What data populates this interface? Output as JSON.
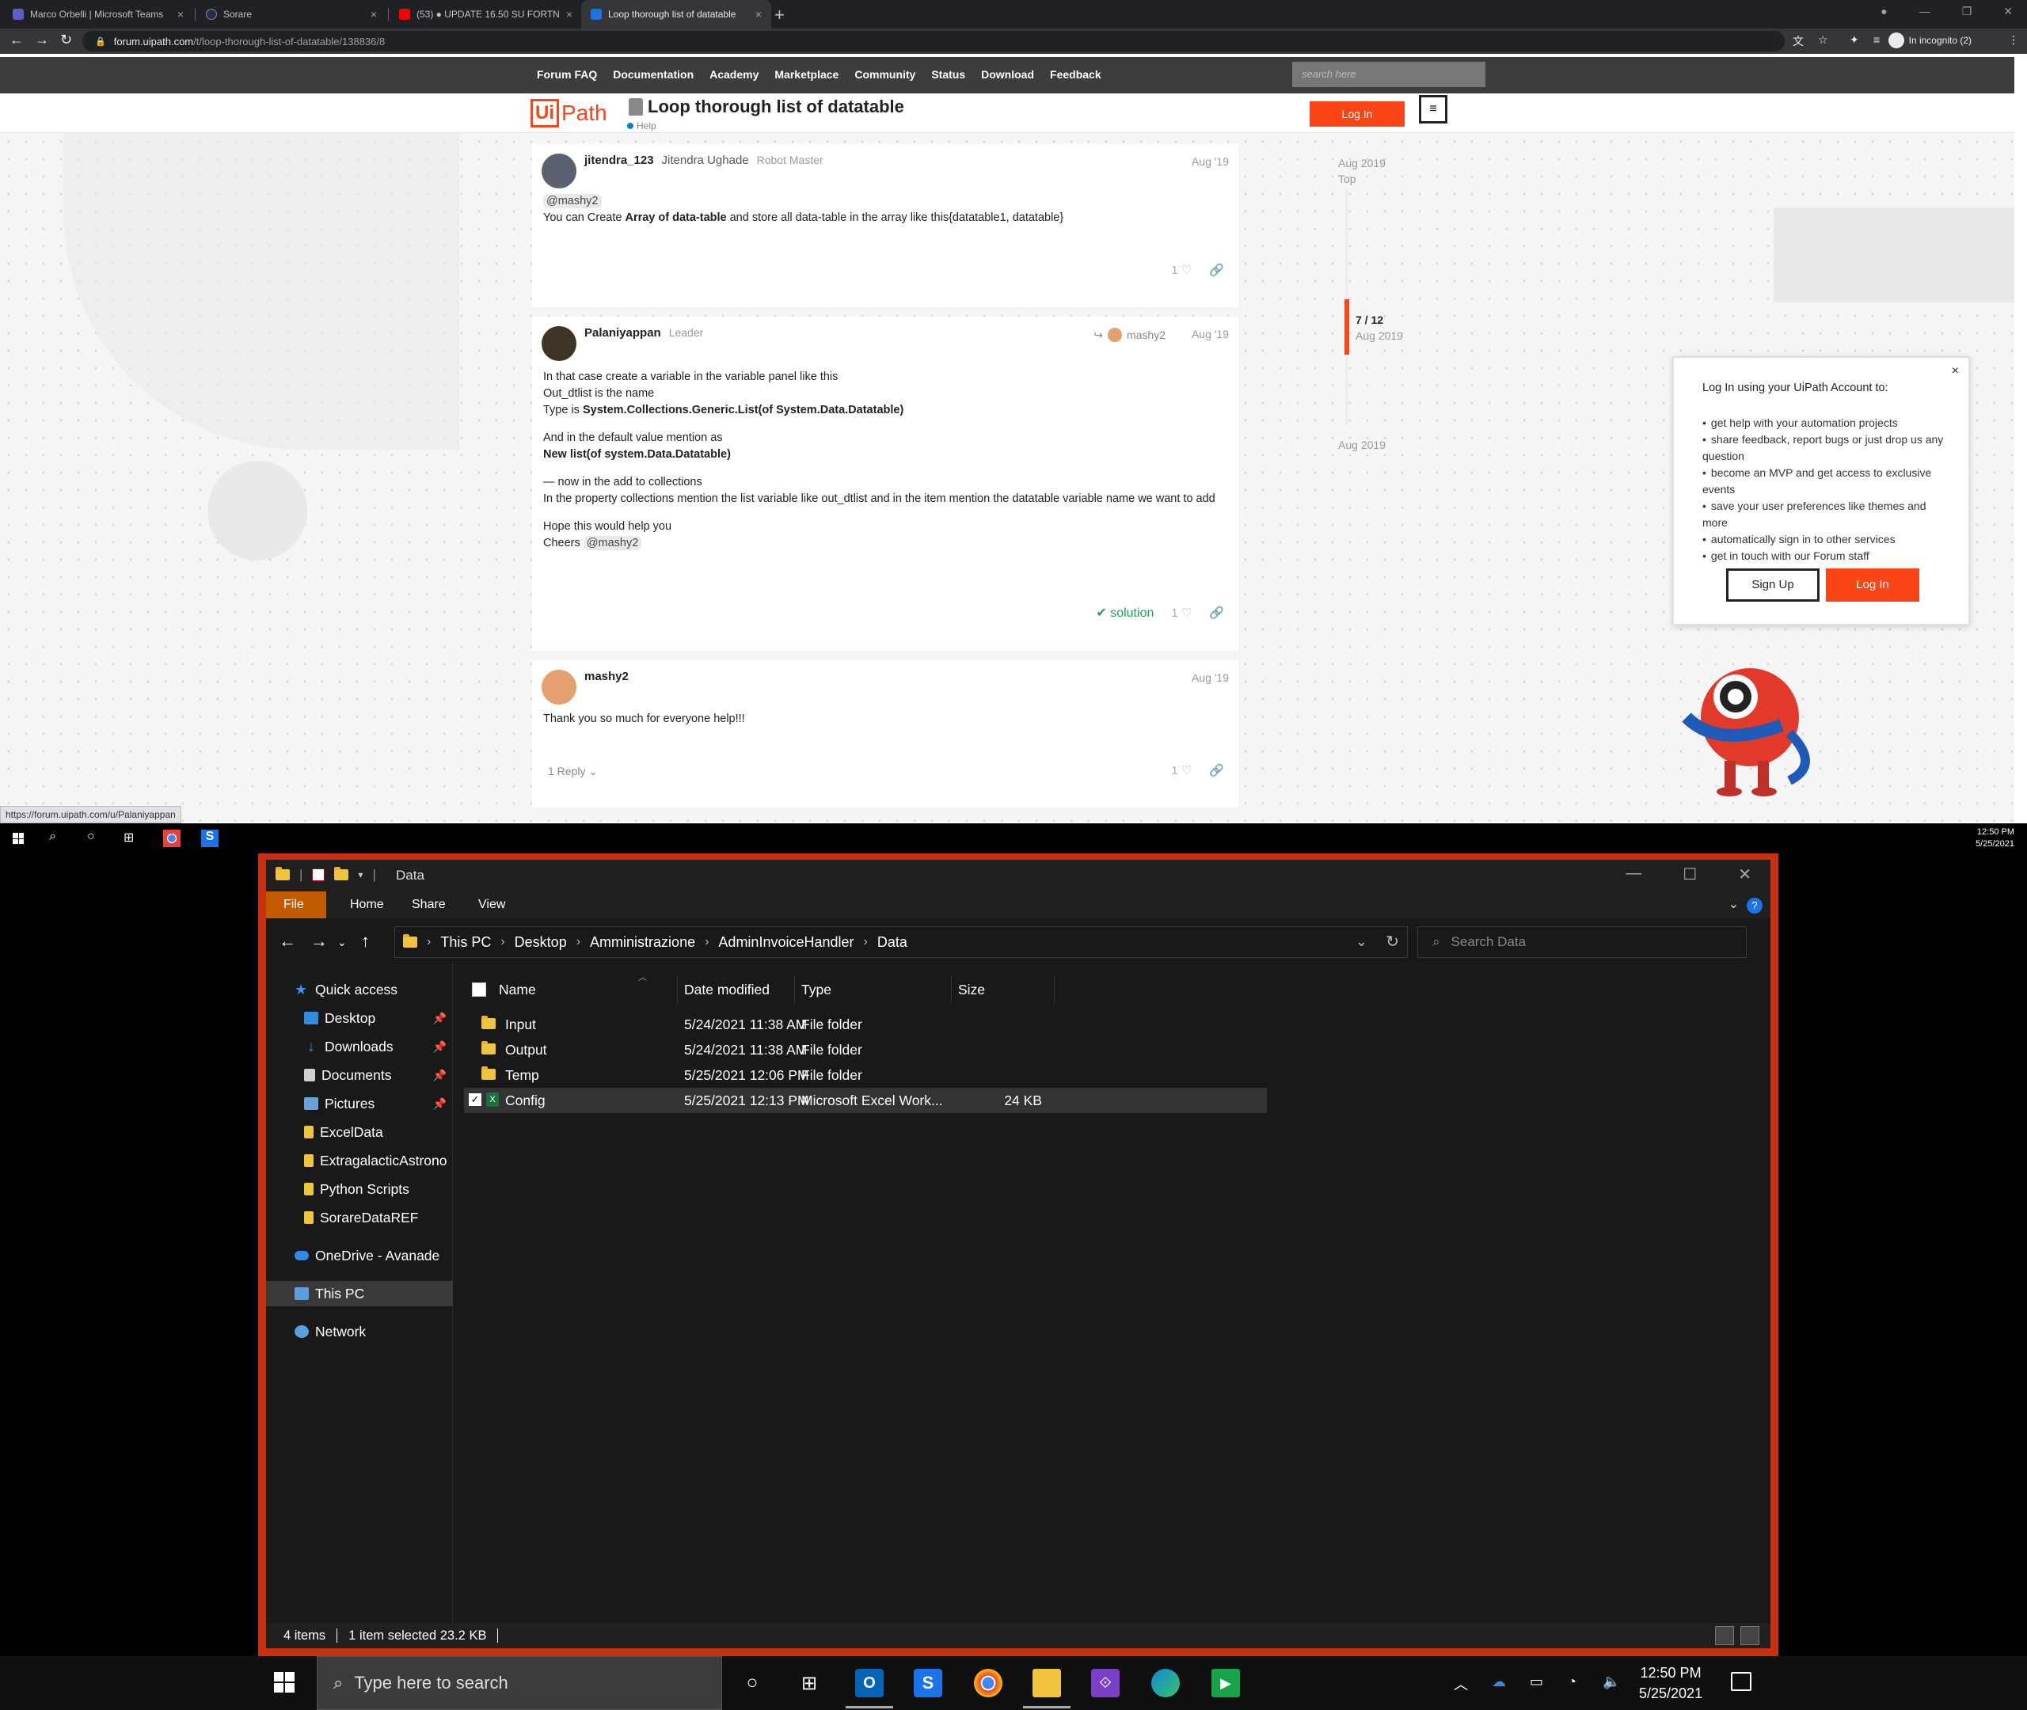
{
  "browser": {
    "tabs": [
      {
        "label": "Marco Orbelli | Microsoft Teams",
        "color": "#5b5fc7"
      },
      {
        "label": "Sorare",
        "color": "#1a1a2e"
      },
      {
        "label": "(53) ● UPDATE 16.50 SU FORTN",
        "color": "#ff0000"
      },
      {
        "label": "Loop thorough list of datatable",
        "color": "#1a73e8"
      }
    ],
    "url_host": "forum.uipath.com",
    "url_path": "/t/loop-thorough-list-of-datatable/138836/8",
    "incognito": "In incognito (2)",
    "status_link": "https://forum.uipath.com/u/Palaniyappan"
  },
  "site": {
    "nav": [
      "Forum FAQ",
      "Documentation",
      "Academy",
      "Marketplace",
      "Community",
      "Status",
      "Download",
      "Feedback"
    ],
    "search_placeholder": "search here",
    "logo_ui": "Ui",
    "logo_path": "Path",
    "topic_title": "Loop thorough list of datatable",
    "category": "Help",
    "login": "Log In",
    "menu_icon": "≡",
    "brand_color": "#fa4616"
  },
  "posts": [
    {
      "username": "jitendra_123",
      "realname": "Jitendra Ughade",
      "title": "Robot Master",
      "date": "Aug '19",
      "mention": "@mashy2",
      "text_pre": "You can Create ",
      "text_bold": "Array of data-table",
      "text_post": " and store all data-table in the array like this{datatable1, datatable}",
      "likes": "1"
    },
    {
      "username": "Palaniyappan",
      "title": "Leader",
      "reply_to": "mashy2",
      "date": "Aug '19",
      "l1": "In that case create a variable in the variable panel like this",
      "l2": "Out_dtlist is the name",
      "l3_pre": "Type is ",
      "l3_bold": "System.Collections.Generic.List(of System.Data.Datatable)",
      "l4": "And in the default value mention as",
      "l5_bold": "New list(of system.Data.Datatable)",
      "l6": "— now in the add to collections",
      "l7": "In the property collections mention the list variable like out_dtlist and in the item mention the datatable variable name we want to add",
      "l8": "Hope this would help you",
      "l9": "Cheers ",
      "mention": "@mashy2",
      "solution": "solution",
      "likes": "1"
    },
    {
      "username": "mashy2",
      "date": "Aug '19",
      "text": "Thank you so much for everyone help!!!",
      "replies": "1 Reply",
      "likes": "1"
    }
  ],
  "timeline": {
    "top_date": "Aug 2019",
    "top_label": "Top",
    "position": "7 / 12",
    "position_date": "Aug 2019",
    "bottom_date": "Aug 2019"
  },
  "login_popup": {
    "heading": "Log In using your UiPath Account to:",
    "items": [
      "get help with your automation projects",
      "share feedback, report bugs or just drop us any question",
      "become an MVP and get access to exclusive events",
      "save your user preferences like themes and more",
      "automatically sign in to other services",
      "get in touch with our Forum staff"
    ],
    "signup": "Sign Up",
    "login": "Log In",
    "close": "×"
  },
  "mini_clock": {
    "time": "12:50 PM",
    "date": "5/25/2021"
  },
  "explorer": {
    "title": "Data",
    "ribbon": [
      "File",
      "Home",
      "Share",
      "View"
    ],
    "breadcrumb": [
      "This PC",
      "Desktop",
      "Amministrazione",
      "AdminInvoiceHandler",
      "Data"
    ],
    "search_placeholder": "Search Data",
    "sidebar": [
      {
        "label": "Quick access",
        "icon": "star-icon",
        "color": "#3c8ee8",
        "indent": 0
      },
      {
        "label": "Desktop",
        "icon": "desktop-icon",
        "color": "#2e8de0",
        "indent": 1,
        "pinned": true
      },
      {
        "label": "Downloads",
        "icon": "download-icon",
        "color": "#3a8ee6",
        "indent": 1,
        "pinned": true
      },
      {
        "label": "Documents",
        "icon": "document-icon",
        "color": "#d0d0d0",
        "indent": 1,
        "pinned": true
      },
      {
        "label": "Pictures",
        "icon": "pictures-icon",
        "color": "#6aa3d6",
        "indent": 1,
        "pinned": true
      },
      {
        "label": "ExcelData",
        "icon": "folder-icon",
        "color": "#f0c43c",
        "indent": 1
      },
      {
        "label": "ExtragalacticAstrono",
        "icon": "folder-icon",
        "color": "#f0c43c",
        "indent": 1
      },
      {
        "label": "Python Scripts",
        "icon": "folder-icon",
        "color": "#f0c43c",
        "indent": 1
      },
      {
        "label": "SorareDataREF",
        "icon": "folder-icon",
        "color": "#f0c43c",
        "indent": 1
      },
      {
        "label": "OneDrive - Avanade",
        "icon": "cloud-icon",
        "color": "#2e8de0",
        "indent": 0
      },
      {
        "label": "This PC",
        "icon": "computer-icon",
        "color": "#5aa0e0",
        "indent": 0,
        "selected": true
      },
      {
        "label": "Network",
        "icon": "network-icon",
        "color": "#5aa0e0",
        "indent": 0
      }
    ],
    "columns": [
      "Name",
      "Date modified",
      "Type",
      "Size"
    ],
    "files": [
      {
        "name": "Input",
        "date": "5/24/2021 11:38 AM",
        "type": "File folder",
        "size": "",
        "kind": "folder"
      },
      {
        "name": "Output",
        "date": "5/24/2021 11:38 AM",
        "type": "File folder",
        "size": "",
        "kind": "folder"
      },
      {
        "name": "Temp",
        "date": "5/25/2021 12:06 PM",
        "type": "File folder",
        "size": "",
        "kind": "folder"
      },
      {
        "name": "Config",
        "date": "5/25/2021 12:13 PM",
        "type": "Microsoft Excel Work...",
        "size": "24 KB",
        "kind": "excel",
        "selected": true
      }
    ],
    "status_items": "4 items",
    "status_selected": "1 item selected  23.2 KB"
  },
  "taskbar": {
    "search": "Type here to search",
    "time": "12:50 PM",
    "date": "5/25/2021"
  }
}
